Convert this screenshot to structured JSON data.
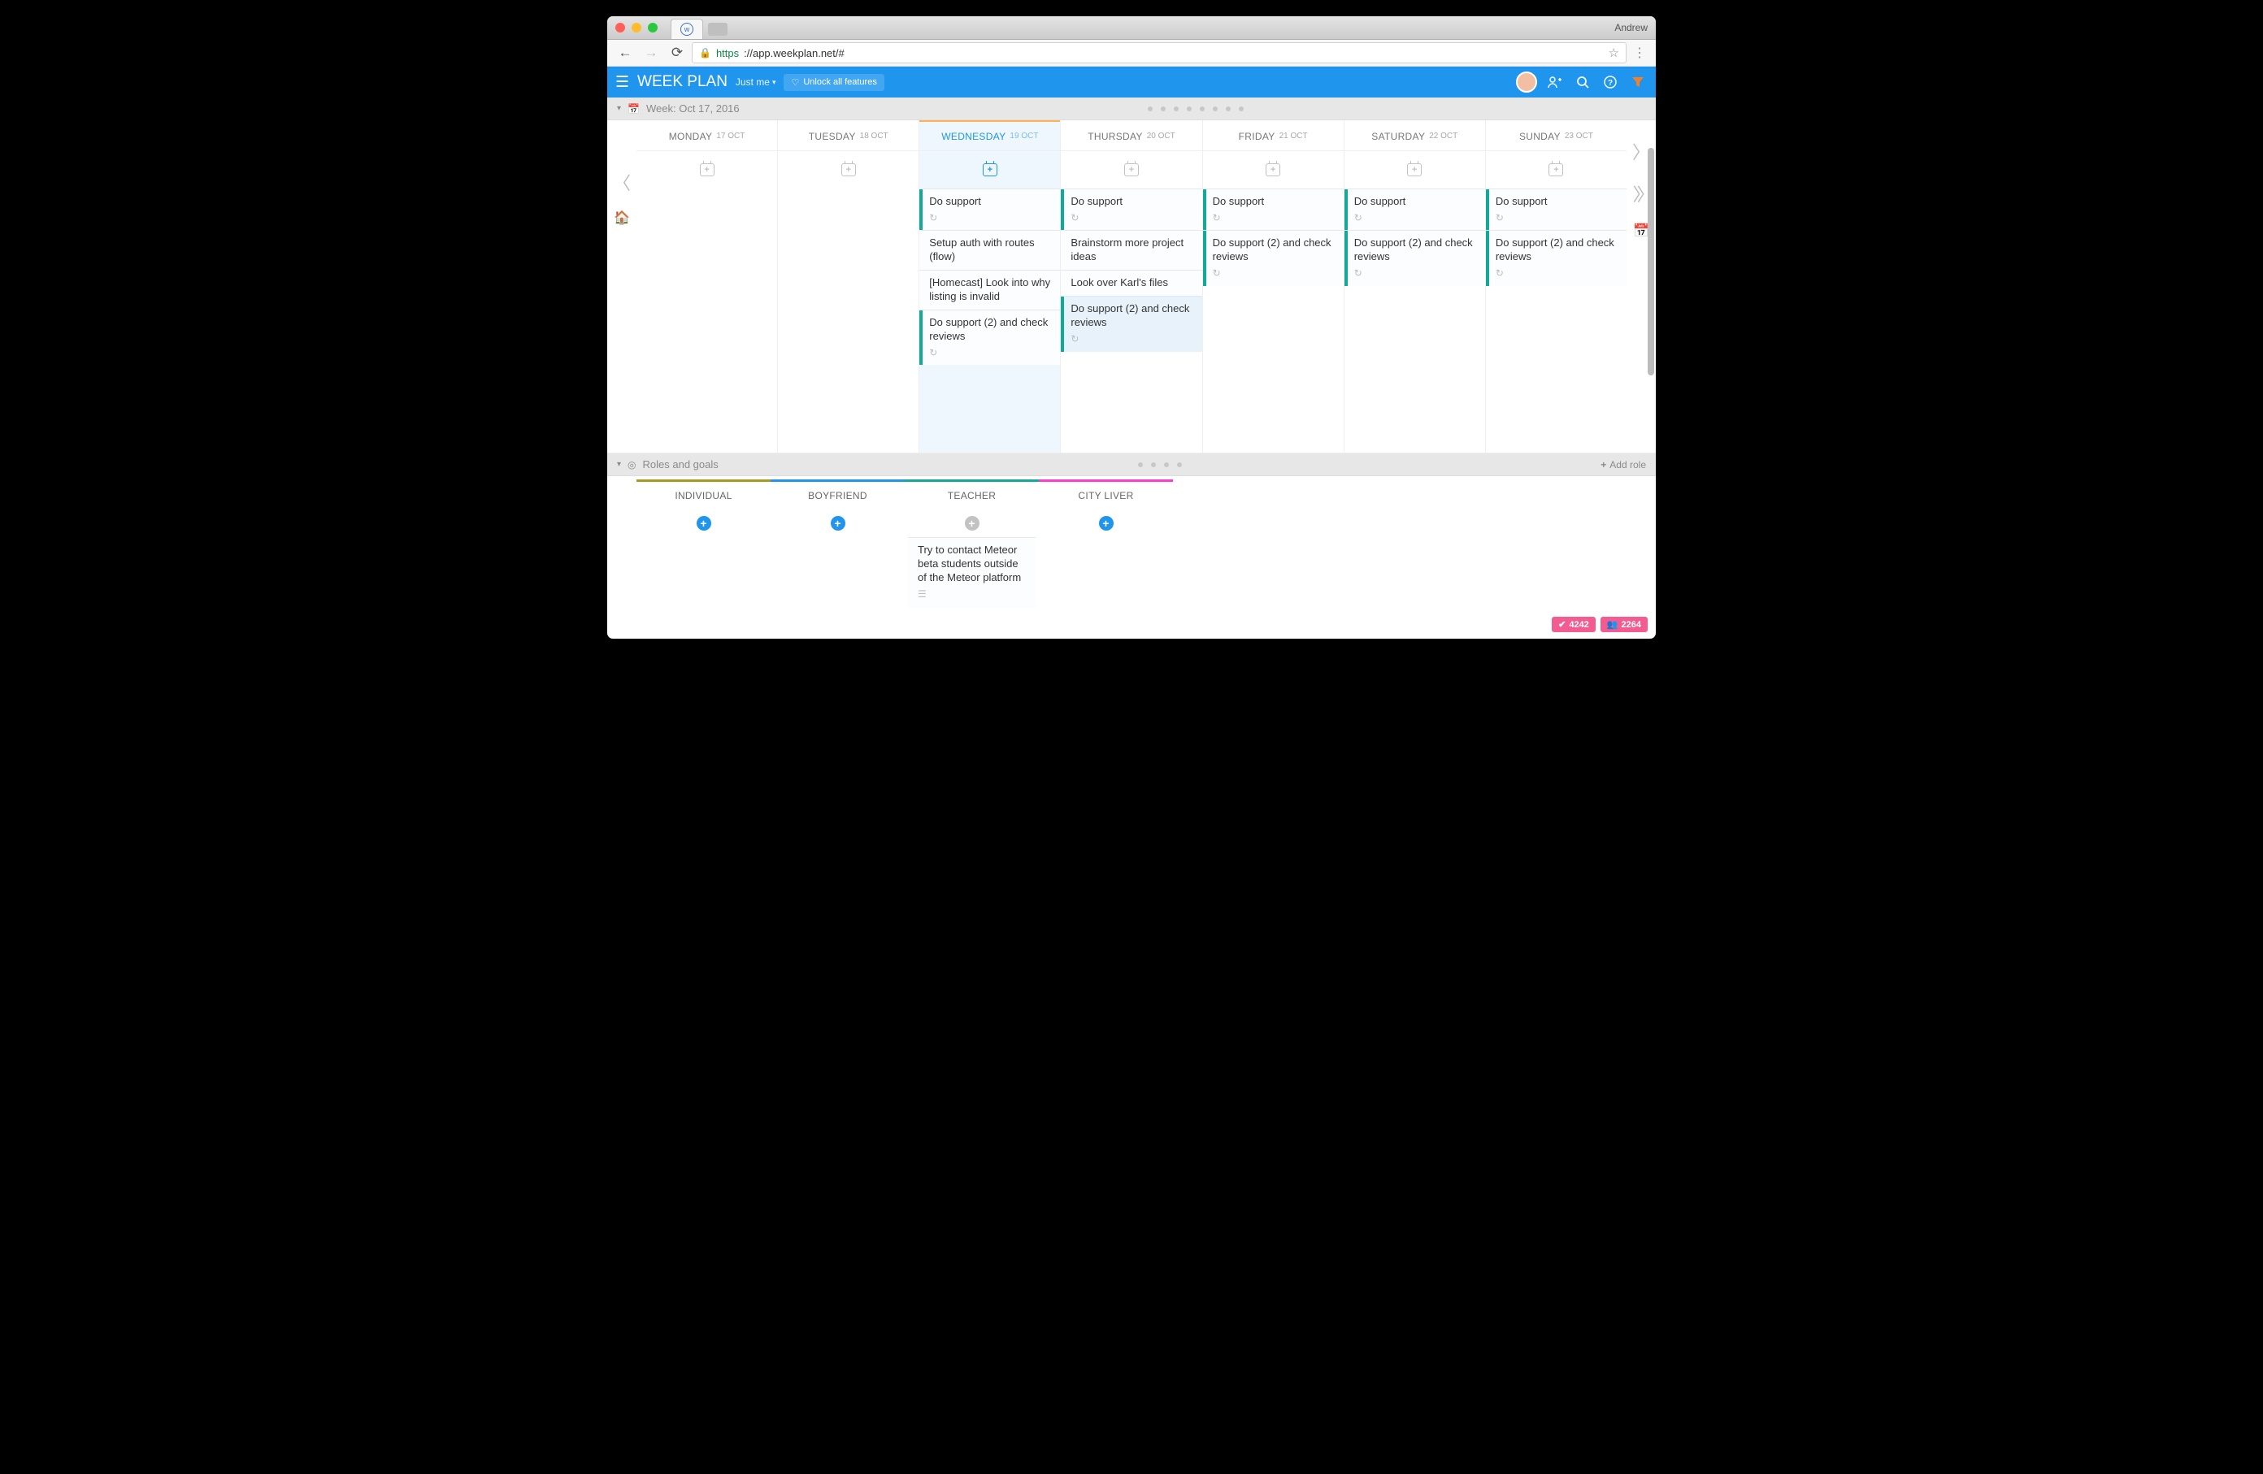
{
  "browser": {
    "profile": "Andrew",
    "url_https": "https",
    "url_rest": "://app.weekplan.net/#"
  },
  "header": {
    "app_title": "WEEK PLAN",
    "workspace": "Just me",
    "unlock_label": "Unlock all features"
  },
  "week_bar": {
    "label": "Week: Oct 17, 2016"
  },
  "days": [
    {
      "name": "MONDAY",
      "date": "17 OCT",
      "today": false,
      "tasks": []
    },
    {
      "name": "TUESDAY",
      "date": "18 OCT",
      "today": false,
      "tasks": []
    },
    {
      "name": "WEDNESDAY",
      "date": "19 OCT",
      "today": true,
      "tasks": [
        {
          "title": "Do support",
          "stripe": true,
          "recur": true
        },
        {
          "title": "Setup auth with routes (flow)",
          "stripe": false,
          "recur": false
        },
        {
          "title": "[Homecast] Look into why listing is invalid",
          "stripe": false,
          "recur": false
        },
        {
          "title": "Do support (2) and check reviews",
          "stripe": true,
          "recur": true
        }
      ]
    },
    {
      "name": "THURSDAY",
      "date": "20 OCT",
      "today": false,
      "tasks": [
        {
          "title": "Do support",
          "stripe": true,
          "recur": true
        },
        {
          "title": "Brainstorm more project ideas",
          "stripe": false,
          "recur": false
        },
        {
          "title": "Look over Karl's files",
          "stripe": false,
          "recur": false
        },
        {
          "title": "Do support (2) and check reviews",
          "stripe": true,
          "recur": true,
          "sel": true
        }
      ]
    },
    {
      "name": "FRIDAY",
      "date": "21 OCT",
      "today": false,
      "tasks": [
        {
          "title": "Do support",
          "stripe": true,
          "recur": true
        },
        {
          "title": "Do support (2) and check reviews",
          "stripe": true,
          "recur": true
        }
      ]
    },
    {
      "name": "SATURDAY",
      "date": "22 OCT",
      "today": false,
      "tasks": [
        {
          "title": "Do support",
          "stripe": true,
          "recur": true
        },
        {
          "title": "Do support (2) and check reviews",
          "stripe": true,
          "recur": true
        }
      ]
    },
    {
      "name": "SUNDAY",
      "date": "23 OCT",
      "today": false,
      "tasks": [
        {
          "title": "Do support",
          "stripe": true,
          "recur": true
        },
        {
          "title": "Do support (2) and check reviews",
          "stripe": true,
          "recur": true
        }
      ]
    }
  ],
  "roles_bar": {
    "label": "Roles and goals",
    "add_role_label": "Add role"
  },
  "roles": [
    {
      "name": "INDIVIDUAL",
      "color": "#a99a1f",
      "plus_grey": false,
      "tasks": []
    },
    {
      "name": "BOYFRIEND",
      "color": "#1f95ee",
      "plus_grey": false,
      "tasks": []
    },
    {
      "name": "TEACHER",
      "color": "#12a999",
      "plus_grey": true,
      "tasks": [
        {
          "title": "Try to contact Meteor beta students outside of the Meteor platform",
          "note": true
        }
      ]
    },
    {
      "name": "CITY LIVER",
      "color": "#ff3ad1",
      "plus_grey": false,
      "tasks": []
    }
  ],
  "footer": {
    "badge1": "4242",
    "badge2": "2264"
  }
}
